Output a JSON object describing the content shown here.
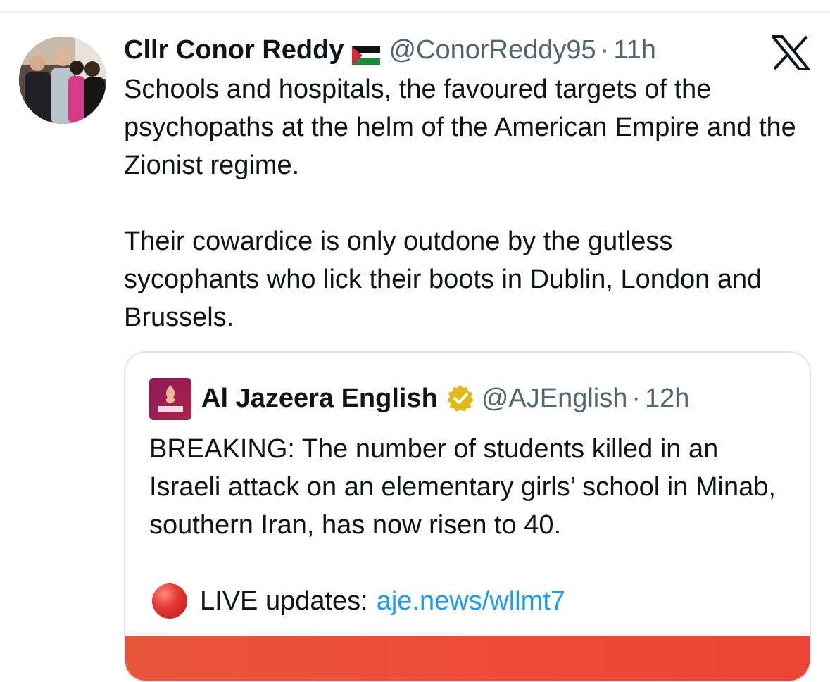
{
  "tweet": {
    "display_name": "Cllr Conor Reddy",
    "flag_icon": "palestine-flag-icon",
    "handle": "@ConorReddy95",
    "separator": "·",
    "time": "11h",
    "platform_icon": "x-logo-icon",
    "paragraphs": [
      "Schools and hospitals, the favoured targets of the psychopaths at the helm of the American Empire and the Zionist regime.",
      "Their cowardice is only outdone by the gutless sycophants who lick their boots in Dublin, London and Brussels."
    ]
  },
  "quoted_tweet": {
    "display_name": "Al Jazeera English",
    "verified_icon": "gold-verified-badge-icon",
    "handle": "@AJEnglish",
    "separator": "·",
    "time": "12h",
    "text": "BREAKING: The number of students killed in an Israeli attack on an elementary girls’ school in Minab, southern Iran, has now risen to 40.",
    "live_label": "LIVE updates:",
    "link": "aje.news/wllmt7",
    "live_icon": "red-circle-icon"
  },
  "colors": {
    "text": "#0f1419",
    "secondary": "#536471",
    "link": "#1d9bf0",
    "verified_gold": "#e2b719",
    "media_red": "#ef4b3a"
  }
}
